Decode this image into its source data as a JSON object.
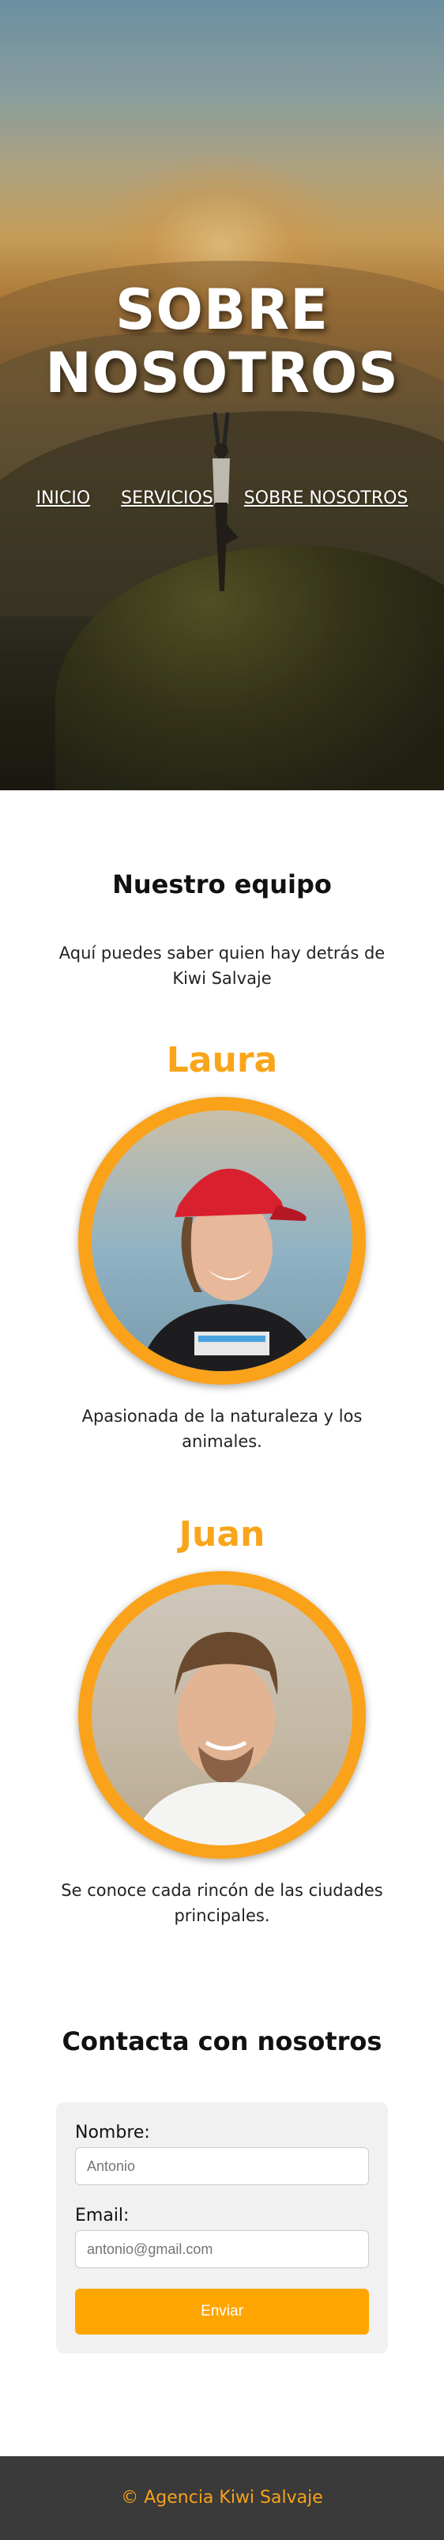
{
  "hero": {
    "title_line1": "SOBRE",
    "title_line2": "NOSOTROS",
    "nav": [
      "INICIO",
      "SERVICIOS",
      "SOBRE NOSOTROS"
    ]
  },
  "team": {
    "title": "Nuestro equipo",
    "intro": "Aquí puedes saber quien hay detrás de Kiwi Salvaje",
    "members": [
      {
        "name": "Laura",
        "description": "Apasionada de la naturaleza y los animales."
      },
      {
        "name": "Juan",
        "description": "Se conoce cada rincón de las ciudades principales."
      }
    ]
  },
  "contact": {
    "title": "Contacta con nosotros",
    "name_label": "Nombre:",
    "name_placeholder": "Antonio",
    "email_label": "Email:",
    "email_placeholder": "antonio@gmail.com",
    "submit_label": "Enviar"
  },
  "footer": {
    "text": "© Agencia Kiwi Salvaje"
  },
  "colors": {
    "accent": "#ffa500",
    "member_name": "#f9a51a",
    "footer_bg": "#3a3a3a"
  }
}
